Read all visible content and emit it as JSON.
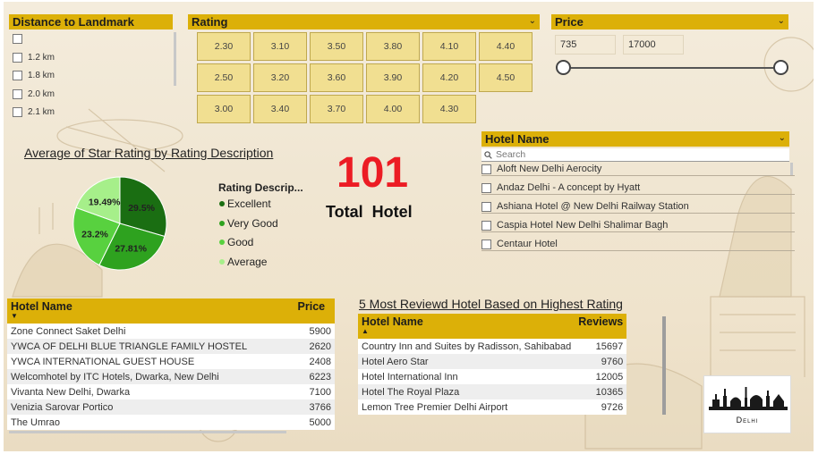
{
  "distance_filter": {
    "title": "Distance to Landmark",
    "items": [
      "",
      "1.2 km",
      "1.8 km",
      "2.0 km",
      "2.1 km"
    ]
  },
  "rating_filter": {
    "title": "Rating",
    "values": [
      "2.30",
      "3.10",
      "3.50",
      "3.80",
      "4.10",
      "4.40",
      "2.50",
      "3.20",
      "3.60",
      "3.90",
      "4.20",
      "4.50",
      "3.00",
      "3.40",
      "3.70",
      "4.00",
      "4.30"
    ]
  },
  "price_filter": {
    "title": "Price",
    "min": "735",
    "max": "17000"
  },
  "pie": {
    "title": "Average of Star Rating by Rating Description",
    "legend_title": "Rating Descrip...",
    "colors": {
      "Excellent": "#1a6e12",
      "Very Good": "#2ea21f",
      "Good": "#58d13f",
      "Average": "#a6ef8a"
    }
  },
  "kpi": {
    "value": "101",
    "label": "Total  Hotel"
  },
  "hotel_name_filter": {
    "title": "Hotel Name",
    "search_placeholder": "Search",
    "items": [
      "Aloft New Delhi Aerocity",
      "Andaz Delhi - A concept by Hyatt",
      "Ashiana Hotel @ New Delhi Railway Station",
      "Caspia Hotel New Delhi Shalimar Bagh",
      "Centaur Hotel"
    ]
  },
  "price_table": {
    "headers": [
      "Hotel Name",
      "Price"
    ],
    "rows": [
      [
        "Zone Connect Saket Delhi",
        "5900"
      ],
      [
        "YWCA OF DELHI BLUE TRIANGLE FAMILY HOSTEL",
        "2620"
      ],
      [
        "YWCA INTERNATIONAL GUEST HOUSE",
        "2408"
      ],
      [
        "Welcomhotel by ITC Hotels, Dwarka, New Delhi",
        "6223"
      ],
      [
        "Vivanta New Delhi, Dwarka",
        "7100"
      ],
      [
        "Venizia Sarovar Portico",
        "3766"
      ],
      [
        "The Umrao",
        "5000"
      ]
    ]
  },
  "reviews_table": {
    "title": "5 Most Reviewd Hotel Based on Highest Rating",
    "headers": [
      "Hotel Name",
      "Reviews"
    ],
    "rows": [
      [
        "Country Inn and Suites by Radisson, Sahibabad",
        "15697"
      ],
      [
        "Hotel Aero Star",
        "9760"
      ],
      [
        "Hotel International Inn",
        "12005"
      ],
      [
        "Hotel The Royal Plaza",
        "10365"
      ],
      [
        "Lemon Tree Premier Delhi Airport",
        "9726"
      ]
    ]
  },
  "logo": {
    "text": "Delhi"
  },
  "chart_data": {
    "type": "pie",
    "title": "Average of Star Rating by Rating Description",
    "legend_title": "Rating Descrip...",
    "legend_position": "right",
    "categories": [
      "Excellent",
      "Very Good",
      "Good",
      "Average"
    ],
    "values": [
      29.5,
      27.81,
      23.2,
      19.49
    ],
    "labels": [
      "29.5%",
      "27.81%",
      "23.2%",
      "19.49%"
    ]
  }
}
